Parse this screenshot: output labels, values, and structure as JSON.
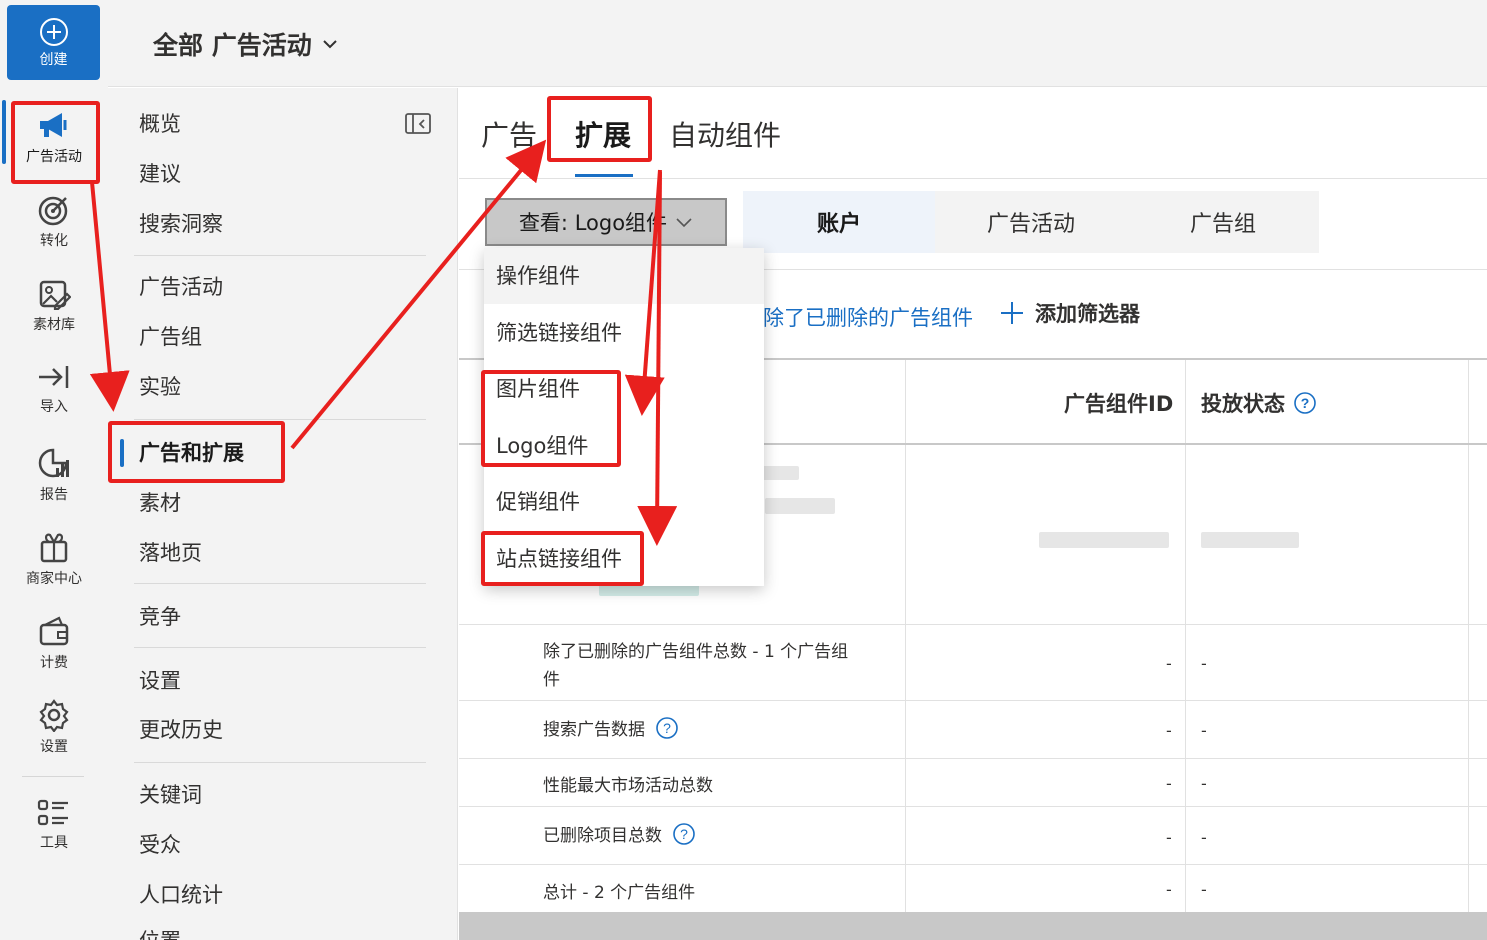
{
  "rail": {
    "create_label": "创建",
    "items": [
      {
        "label": "广告活动",
        "icon": "megaphone-icon"
      },
      {
        "label": "转化",
        "icon": "target-icon"
      },
      {
        "label": "素材库",
        "icon": "image-edit-icon"
      },
      {
        "label": "导入",
        "icon": "import-icon"
      },
      {
        "label": "报告",
        "icon": "report-icon"
      },
      {
        "label": "商家中心",
        "icon": "gift-icon"
      },
      {
        "label": "计费",
        "icon": "wallet-icon"
      },
      {
        "label": "设置",
        "icon": "gear-icon"
      },
      {
        "label": "工具",
        "icon": "tools-list-icon"
      }
    ]
  },
  "header": {
    "scope_label": "全部 广告活动"
  },
  "subnav": {
    "items": [
      "概览",
      "建议",
      "搜索洞察",
      "广告活动",
      "广告组",
      "实验",
      "广告和扩展",
      "素材",
      "落地页",
      "竞争",
      "设置",
      "更改历史",
      "关键词",
      "受众",
      "人口统计",
      "位置"
    ],
    "active": "广告和扩展"
  },
  "main": {
    "tabs": [
      "广告",
      "扩展",
      "自动组件"
    ],
    "active_tab": "扩展",
    "view_select": "查看: Logo组件",
    "level_tabs": [
      "账户",
      "广告活动",
      "广告组"
    ],
    "active_level": "账户",
    "filter_text": "除了已删除的广告组件",
    "add_filter": "添加筛选器",
    "columns": [
      "广告组件ID",
      "投放状态"
    ],
    "summary_rows": [
      {
        "label": "除了已删除的广告组件总数 - 1 个广告组",
        "label2": "件",
        "id": "-",
        "status": "-",
        "help": false
      },
      {
        "label": "搜索广告数据",
        "id": "-",
        "status": "-",
        "help": true
      },
      {
        "label": "性能最大市场活动总数",
        "id": "-",
        "status": "-",
        "help": false
      },
      {
        "label": "已删除项目总数",
        "id": "-",
        "status": "-",
        "help": true
      },
      {
        "label": "总计 - 2 个广告组件",
        "id": "-",
        "status": "-",
        "help": false
      }
    ]
  },
  "dropdown": {
    "items": [
      "操作组件",
      "筛选链接组件",
      "图片组件",
      "Logo组件",
      "促销组件",
      "站点链接组件"
    ]
  },
  "colors": {
    "accent": "#1a6fc4",
    "annotation_red": "#e8201e"
  }
}
